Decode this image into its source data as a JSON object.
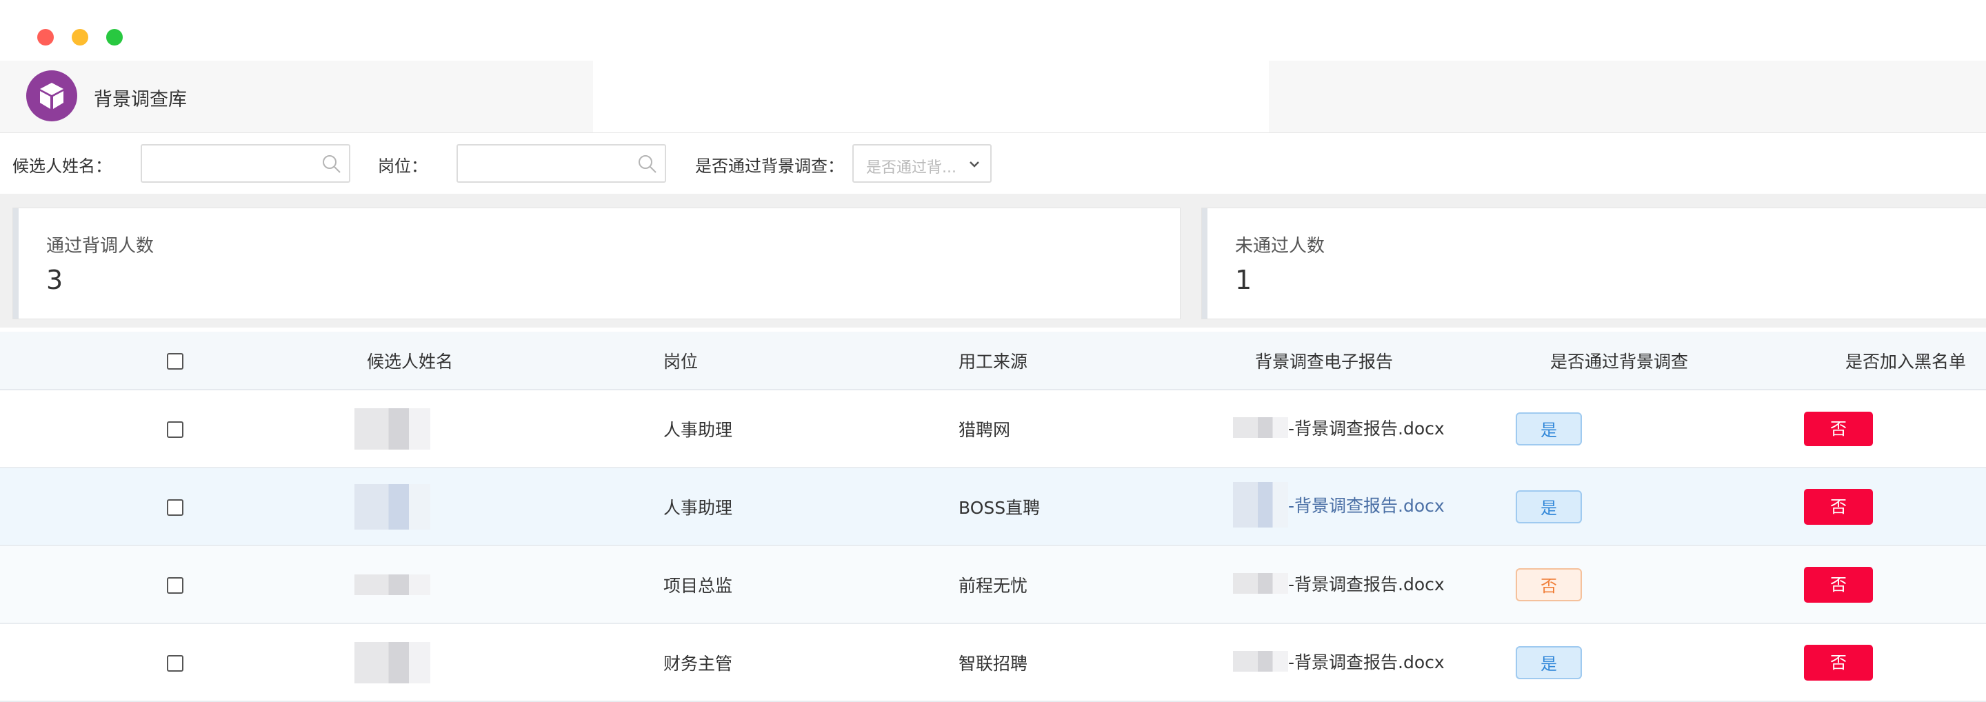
{
  "window": {
    "traffic_lights": [
      "#ff5f57",
      "#febc2e",
      "#28c840"
    ]
  },
  "header": {
    "app_title": "背景调查库",
    "logo_icon": "cube-icon",
    "logo_color": "#8e3d9a"
  },
  "filters": {
    "name_label": "候选人姓名：",
    "name_value": "",
    "position_label": "岗位：",
    "position_value": "",
    "passed_label": "是否通过背景调查：",
    "passed_placeholder": "是否通过背...",
    "search_icon": "search-icon",
    "dropdown_icon": "chevron-down-icon"
  },
  "stats": [
    {
      "label": "通过背调人数",
      "value": "3"
    },
    {
      "label": "未通过人数",
      "value": "1"
    }
  ],
  "table": {
    "columns": [
      "候选人姓名",
      "岗位",
      "用工来源",
      "背景调查电子报告",
      "是否通过背景调查",
      "是否加入黑名单"
    ],
    "rows": [
      {
        "position": "人事助理",
        "source": "猎聘网",
        "report": "-背景调查报告.docx",
        "passed": "是",
        "blacklist": "否"
      },
      {
        "position": "人事助理",
        "source": "BOSS直聘",
        "report": "-背景调查报告.docx",
        "passed": "是",
        "blacklist": "否"
      },
      {
        "position": "项目总监",
        "source": "前程无忧",
        "report": "-背景调查报告.docx",
        "passed": "否",
        "blacklist": "否"
      },
      {
        "position": "财务主管",
        "source": "智联招聘",
        "report": "-背景调查报告.docx",
        "passed": "是",
        "blacklist": "否"
      }
    ]
  },
  "colors": {
    "accent_purple": "#8e3d9a",
    "blacklist_red": "#f6053c",
    "yes_blue": "#2f86d8",
    "no_orange": "#f07f3a"
  }
}
